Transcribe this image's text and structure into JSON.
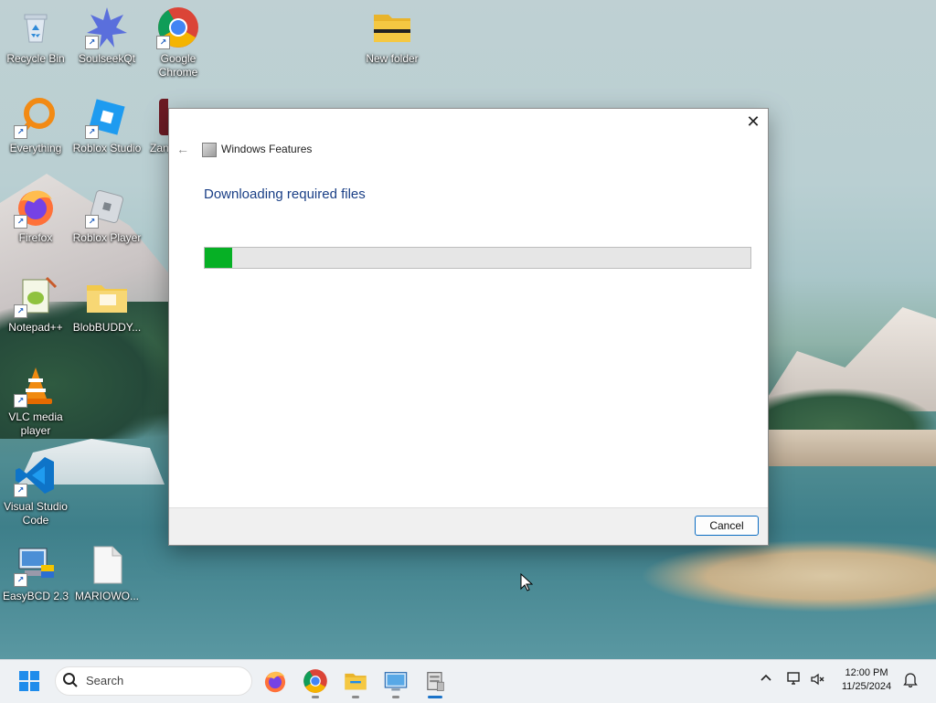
{
  "desktop": {
    "icons": [
      {
        "label": "Recycle Bin"
      },
      {
        "label": "SoulseekQt"
      },
      {
        "label": "Google Chrome"
      },
      {
        "label": "New folder"
      },
      {
        "label": "Everything"
      },
      {
        "label": "Roblox Studio"
      },
      {
        "label": "Zan"
      },
      {
        "label": "Firefox"
      },
      {
        "label": "Roblox Player"
      },
      {
        "label": "Notepad++"
      },
      {
        "label": "BlobBUDDY..."
      },
      {
        "label": "VLC media player"
      },
      {
        "label": "Visual Studio Code"
      },
      {
        "label": "EasyBCD 2.3"
      },
      {
        "label": "MARIOWO..."
      }
    ]
  },
  "dialog": {
    "title": "Windows Features",
    "heading": "Downloading required files",
    "progress_fraction": 0.05,
    "progress_color": "#06b025",
    "cancel_label": "Cancel"
  },
  "taskbar": {
    "search_placeholder": "Search",
    "apps": [
      "firefox-icon",
      "chrome-icon",
      "file-explorer-icon",
      "control-panel-icon",
      "windows-features-icon"
    ],
    "time": "12:00 PM",
    "date": "11/25/2024"
  }
}
